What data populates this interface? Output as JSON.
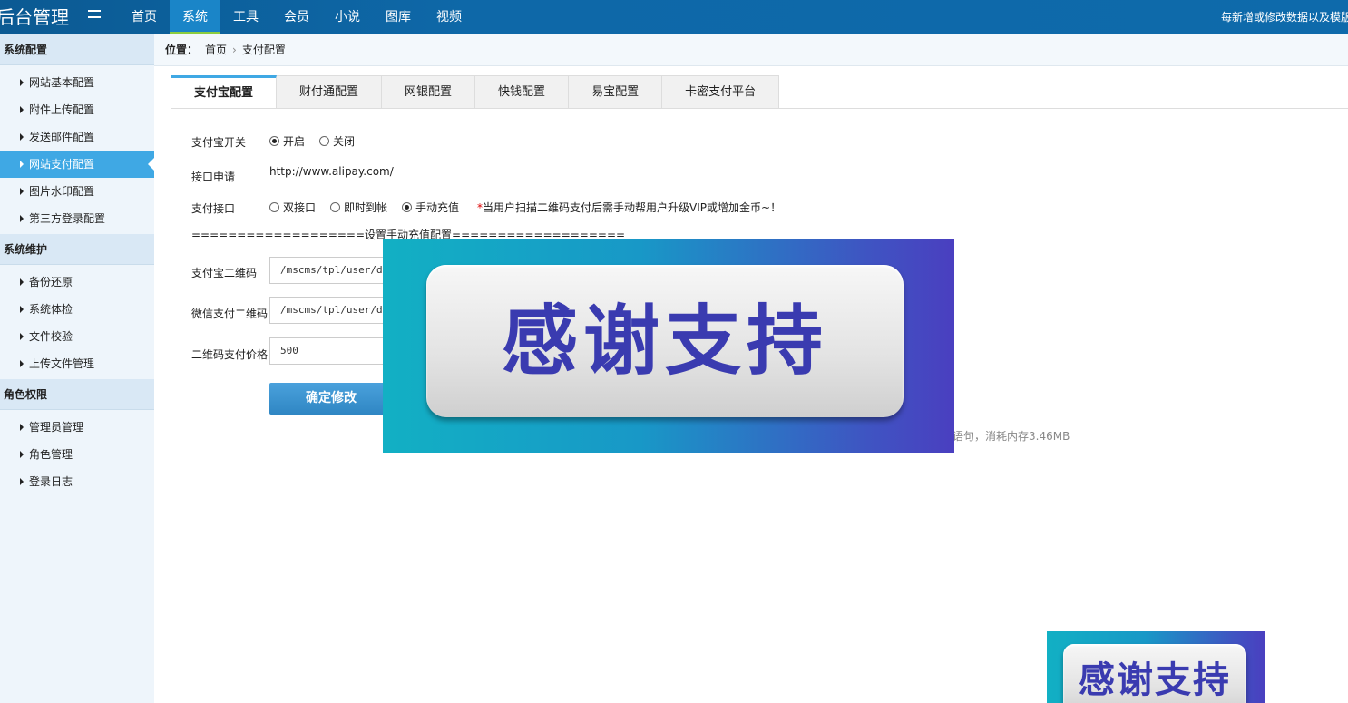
{
  "header": {
    "logo": "后台管理",
    "nav": [
      "首页",
      "系统",
      "工具",
      "会员",
      "小说",
      "图库",
      "视频"
    ],
    "active_nav": "系统",
    "notice": "每新增或修改数据以及模版"
  },
  "sidebar": {
    "groups": [
      {
        "title": "系统配置",
        "items": [
          "网站基本配置",
          "附件上传配置",
          "发送邮件配置",
          "网站支付配置",
          "图片水印配置",
          "第三方登录配置"
        ],
        "active": "网站支付配置"
      },
      {
        "title": "系统维护",
        "items": [
          "备份还原",
          "系统体检",
          "文件校验",
          "上传文件管理"
        ]
      },
      {
        "title": "角色权限",
        "items": [
          "管理员管理",
          "角色管理",
          "登录日志"
        ]
      }
    ]
  },
  "breadcrumb": {
    "label": "位置：",
    "home": "首页",
    "separator": "›",
    "current": "支付配置"
  },
  "tabs": [
    "支付宝配置",
    "财付通配置",
    "网银配置",
    "快钱配置",
    "易宝配置",
    "卡密支付平台"
  ],
  "active_tab": "支付宝配置",
  "form": {
    "switch": {
      "label": "支付宝开关",
      "options": [
        "开启",
        "关闭"
      ],
      "selected": "开启"
    },
    "apply": {
      "label": "接口申请",
      "value": "http://www.alipay.com/"
    },
    "interface": {
      "label": "支付接口",
      "options": [
        "双接口",
        "即时到帐",
        "手动充值"
      ],
      "selected": "手动充值",
      "note_star": "*",
      "note": "当用户扫描二维码支付后需手动帮用户升级VIP或增加金币~！"
    },
    "divider": "===================设置手动充值配置===================",
    "alipay_qr": {
      "label": "支付宝二维码",
      "value": "/mscms/tpl/user/def"
    },
    "wechat_qr": {
      "label": "微信支付二维码",
      "value": "/mscms/tpl/user/def"
    },
    "qr_price": {
      "label": "二维码支付价格",
      "value": "500"
    },
    "submit": "确定修改"
  },
  "footer_stats": "语句，消耗内存3.46MB",
  "overlay": {
    "banner_text": "感谢支持"
  },
  "colors": {
    "topbar": "#0e68a8",
    "active_nav": "#1a85c8",
    "sidebar_active": "#3fa8e4",
    "button": "#3d94cf",
    "banner_text": "#3a3bb0"
  }
}
